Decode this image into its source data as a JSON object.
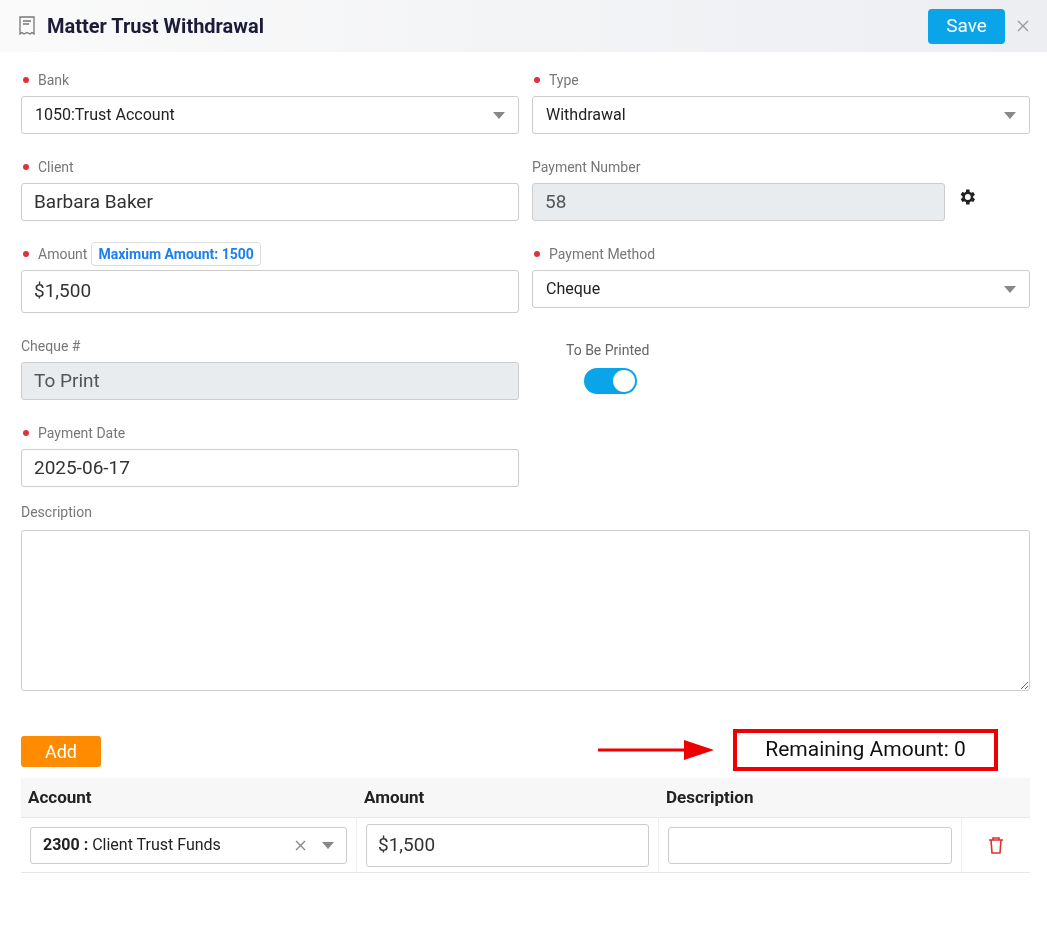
{
  "window": {
    "title": "Matter Trust Withdrawal",
    "save_button": "Save"
  },
  "form_rows": [
    [
      {
        "kind": "select",
        "label": "Bank",
        "required": true,
        "value": "1050:Trust Account"
      },
      {
        "kind": "select",
        "label": "Type",
        "required": true,
        "value": "Withdrawal"
      }
    ],
    [
      {
        "kind": "input",
        "label": "Client",
        "required": true,
        "value": "Barbara Baker"
      },
      {
        "kind": "readonly",
        "label": "Payment Number",
        "required": false,
        "value": "58",
        "settings": true
      }
    ],
    [
      {
        "kind": "input",
        "label": "Amount",
        "required": true,
        "value": "$1,500",
        "badge": "Maximum Amount: 1500"
      },
      {
        "kind": "select",
        "label": "Payment Method",
        "required": true,
        "value": "Cheque"
      }
    ],
    [
      {
        "kind": "readonly",
        "label": "Cheque #",
        "required": false,
        "value": "To Print",
        "settings": false
      },
      {
        "kind": "toggle",
        "label": "To Be Printed",
        "on": true
      }
    ],
    [
      {
        "kind": "input",
        "label": "Payment Date",
        "required": true,
        "value": "2025-06-17"
      }
    ]
  ],
  "description": {
    "label": "Description"
  },
  "add_button": "Add",
  "remaining": {
    "text": "Remaining Amount: 0",
    "highlighted": true
  },
  "table": {
    "columns": [
      "Account",
      "Amount",
      "Description"
    ],
    "rows": [
      {
        "account": "**2300 :** Client Trust Funds",
        "amount": "$1,500"
      }
    ]
  }
}
